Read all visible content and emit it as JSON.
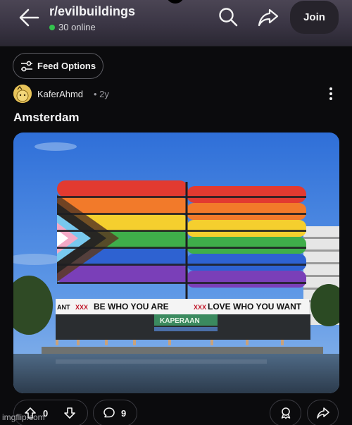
{
  "header": {
    "subreddit": "r/evilbuildings",
    "online_text": "30 online",
    "join_label": "Join"
  },
  "feed": {
    "options_label": "Feed Options"
  },
  "post": {
    "author": "KaferAhmd",
    "time": "• 2y",
    "title": "Amsterdam",
    "image": {
      "banner_left": "BE WHO YOU ARE",
      "banner_right": "LOVE WHO YOU WANT",
      "banner_marks": "XXX",
      "banner_partial_left": "ANT",
      "shop_sign": "KAPERAAN"
    },
    "upvotes": "0",
    "comments": "9"
  },
  "watermark": "imgflip.com",
  "colors": {
    "header_bg": "#3a3544",
    "page_bg": "#0b0b0d",
    "online_dot": "#33c24d",
    "join_bg": "#26232b"
  },
  "icons": {
    "back": "arrow-left-icon",
    "search": "search-icon",
    "share": "share-icon",
    "feed": "sliders-icon",
    "more": "vertical-dots-icon",
    "upvote": "upvote-arrow-icon",
    "downvote": "downvote-arrow-icon",
    "comment": "comment-bubble-icon",
    "award": "award-icon"
  }
}
